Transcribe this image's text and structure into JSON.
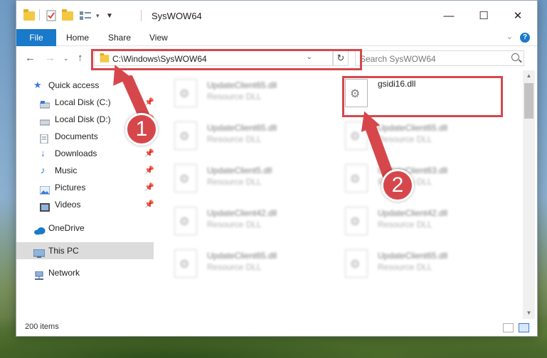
{
  "window": {
    "title": "SysWOW64",
    "controls": {
      "minimize": "—",
      "maximize": "☐",
      "close": "✕"
    }
  },
  "ribbon": {
    "tabs": [
      "File",
      "Home",
      "Share",
      "View"
    ],
    "help": "?"
  },
  "navigation": {
    "address": "C:\\Windows\\SysWOW64",
    "search_placeholder": "Search SysWOW64"
  },
  "sidebar": {
    "items": [
      {
        "label": "Quick access",
        "icon": "star-icon",
        "pinned": false
      },
      {
        "label": "Local Disk (C:)",
        "icon": "drive-icon",
        "pinned": true
      },
      {
        "label": "Local Disk (D:)",
        "icon": "drive-icon",
        "pinned": true
      },
      {
        "label": "Documents",
        "icon": "document-icon",
        "pinned": true
      },
      {
        "label": "Downloads",
        "icon": "download-icon",
        "pinned": true
      },
      {
        "label": "Music",
        "icon": "music-icon",
        "pinned": true
      },
      {
        "label": "Pictures",
        "icon": "pictures-icon",
        "pinned": true
      },
      {
        "label": "Videos",
        "icon": "video-icon",
        "pinned": true
      },
      {
        "label": "OneDrive",
        "icon": "cloud-icon",
        "pinned": false
      },
      {
        "label": "This PC",
        "icon": "computer-icon",
        "pinned": false,
        "selected": true
      },
      {
        "label": "Network",
        "icon": "network-icon",
        "pinned": false
      }
    ]
  },
  "files": {
    "left_column": [
      {
        "name": "UpdateClient65.dll",
        "type": "Resource DLL"
      },
      {
        "name": "UpdateClient65.dll",
        "type": "Resource DLL"
      },
      {
        "name": "UpdateClient5.dll",
        "type": "Resource DLL"
      },
      {
        "name": "UpdateClient42.dll",
        "type": "Resource DLL"
      },
      {
        "name": "UpdateClient65.dll",
        "type": "Resource DLL"
      }
    ],
    "highlighted": {
      "name": "gsidi16.dll"
    },
    "right_column": [
      {
        "name": "UpdateClient65.dll",
        "type": "Resource DLL"
      },
      {
        "name": "UpdateClient63.dll",
        "type": "Resource DLL"
      },
      {
        "name": "UpdateClient42.dll",
        "type": "Resource DLL"
      },
      {
        "name": "UpdateClient65.dll",
        "type": "Resource DLL"
      }
    ]
  },
  "status": {
    "item_count": "200 items"
  },
  "annotations": {
    "badge_1": "1",
    "badge_2": "2",
    "color": "#d6474c"
  }
}
